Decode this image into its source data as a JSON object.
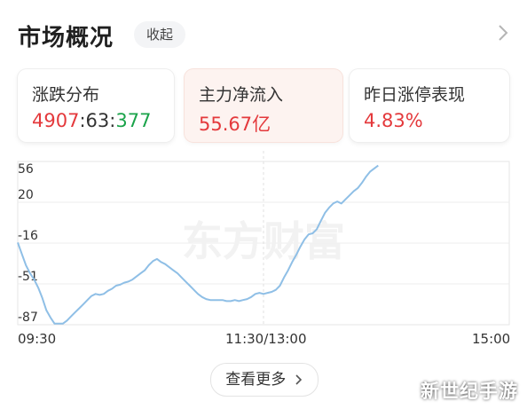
{
  "header": {
    "title": "市场概况",
    "collapse_label": "收起"
  },
  "cards": [
    {
      "label": "涨跌分布",
      "up": "4907",
      "flat": "63",
      "down": "377",
      "sep": ":"
    },
    {
      "label": "主力净流入",
      "value": "55.67亿"
    },
    {
      "label": "昨日涨停表现",
      "value": "4.83%"
    }
  ],
  "chart": {
    "watermark": "东方财富",
    "y_ticks": [
      "56",
      "20",
      "-16",
      "-51",
      "-87"
    ],
    "x_ticks": [
      "09:30",
      "11:30/13:00",
      "15:00"
    ]
  },
  "chart_data": {
    "type": "line",
    "y_ticks": [
      56,
      20,
      -16,
      -51,
      -87
    ],
    "ylim": [
      -96,
      63
    ],
    "x_labels": [
      "09:30",
      "11:30/13:00",
      "15:00"
    ],
    "x_index_range": [
      0,
      240
    ],
    "points": [
      [
        0,
        -16
      ],
      [
        2,
        -27
      ],
      [
        4,
        -38
      ],
      [
        6,
        -46
      ],
      [
        8,
        -52
      ],
      [
        10,
        -60
      ],
      [
        12,
        -70
      ],
      [
        14,
        -82
      ],
      [
        16,
        -89
      ],
      [
        18,
        -95
      ],
      [
        20,
        -95
      ],
      [
        22,
        -95
      ],
      [
        24,
        -92
      ],
      [
        26,
        -88
      ],
      [
        28,
        -84
      ],
      [
        30,
        -80
      ],
      [
        32,
        -76
      ],
      [
        34,
        -72
      ],
      [
        36,
        -68
      ],
      [
        38,
        -66
      ],
      [
        40,
        -67
      ],
      [
        42,
        -66
      ],
      [
        44,
        -63
      ],
      [
        46,
        -61
      ],
      [
        48,
        -58
      ],
      [
        50,
        -57
      ],
      [
        52,
        -55
      ],
      [
        54,
        -54
      ],
      [
        56,
        -52
      ],
      [
        58,
        -49
      ],
      [
        60,
        -46
      ],
      [
        62,
        -43
      ],
      [
        64,
        -38
      ],
      [
        66,
        -34
      ],
      [
        68,
        -32
      ],
      [
        70,
        -35
      ],
      [
        72,
        -37
      ],
      [
        74,
        -40
      ],
      [
        76,
        -43
      ],
      [
        78,
        -46
      ],
      [
        80,
        -50
      ],
      [
        82,
        -54
      ],
      [
        84,
        -58
      ],
      [
        86,
        -62
      ],
      [
        88,
        -66
      ],
      [
        90,
        -69
      ],
      [
        92,
        -71
      ],
      [
        94,
        -72
      ],
      [
        96,
        -72
      ],
      [
        98,
        -72
      ],
      [
        100,
        -72
      ],
      [
        102,
        -73
      ],
      [
        104,
        -73
      ],
      [
        106,
        -72
      ],
      [
        108,
        -73
      ],
      [
        110,
        -72
      ],
      [
        112,
        -71
      ],
      [
        114,
        -69
      ],
      [
        116,
        -66
      ],
      [
        118,
        -65
      ],
      [
        120,
        -66
      ],
      [
        122,
        -65
      ],
      [
        124,
        -64
      ],
      [
        126,
        -62
      ],
      [
        128,
        -58
      ],
      [
        130,
        -50
      ],
      [
        132,
        -43
      ],
      [
        134,
        -35
      ],
      [
        136,
        -28
      ],
      [
        138,
        -20
      ],
      [
        140,
        -13
      ],
      [
        142,
        -8
      ],
      [
        144,
        -7
      ],
      [
        146,
        -3
      ],
      [
        148,
        5
      ],
      [
        150,
        13
      ],
      [
        152,
        18
      ],
      [
        154,
        22
      ],
      [
        156,
        24
      ],
      [
        158,
        22
      ],
      [
        160,
        26
      ],
      [
        162,
        30
      ],
      [
        164,
        34
      ],
      [
        166,
        37
      ],
      [
        168,
        42
      ],
      [
        170,
        48
      ],
      [
        172,
        53
      ],
      [
        174,
        56
      ],
      [
        176,
        59
      ]
    ]
  }
}
